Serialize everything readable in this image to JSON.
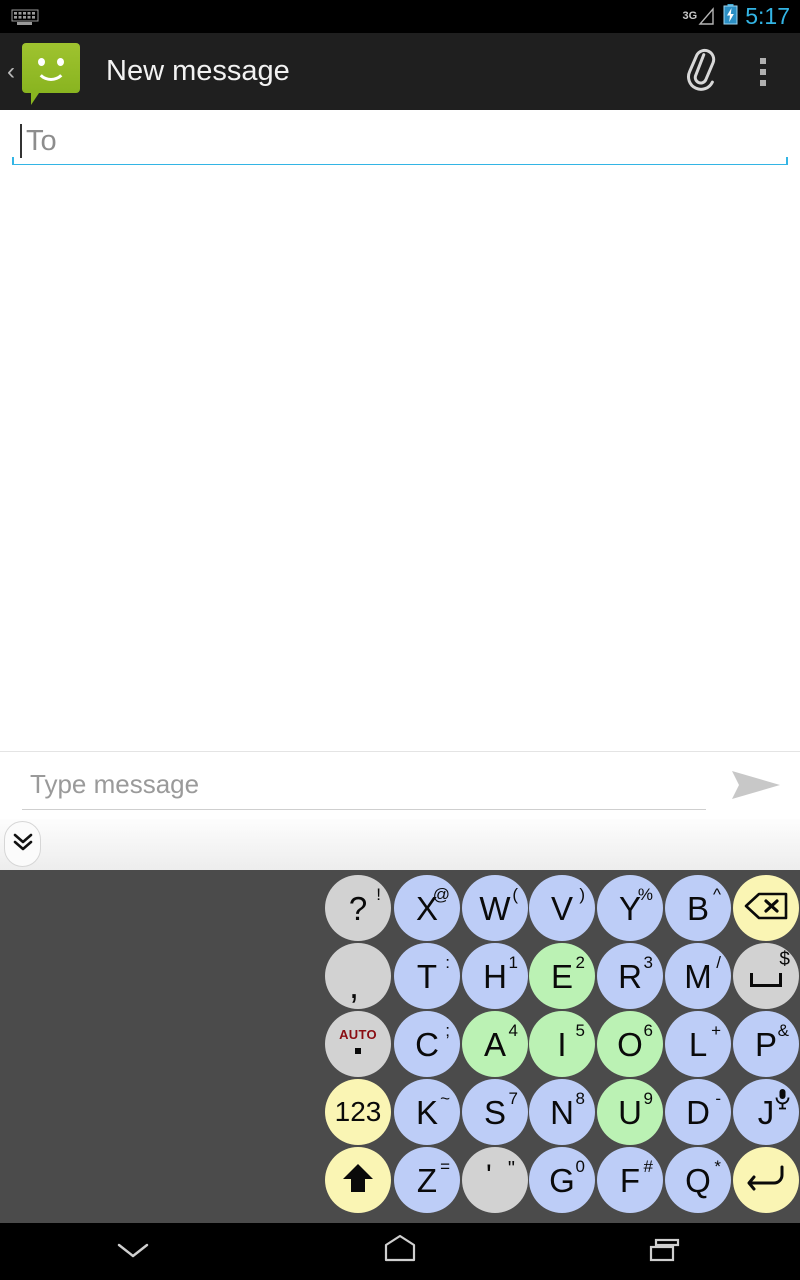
{
  "status_bar": {
    "keyboard_icon": "keyboard-icon",
    "network_type": "3G",
    "signal_icon": "signal-bars-icon",
    "battery_icon": "battery-charging-icon",
    "time": "5:17"
  },
  "action_bar": {
    "back_chevron": "‹",
    "app_icon": "messaging-app-icon",
    "title": "New message",
    "attach_icon": "paperclip-icon",
    "overflow_icon": "overflow-menu-icon"
  },
  "recipient": {
    "placeholder": "To",
    "value": "",
    "underline_color": "#33b5e5"
  },
  "compose": {
    "placeholder": "Type message",
    "value": "",
    "send_icon": "send-arrow-icon"
  },
  "keyboard_strip": {
    "hide_keyboard_icon": "double-chevron-down-icon"
  },
  "keyboard": {
    "background": "#4b4b4b",
    "colors": {
      "consonant": "#bdcdf7",
      "vowel": "#bbf2b4",
      "punctuation": "#d2d2d2",
      "function": "#faf5b4"
    },
    "rows": [
      [
        {
          "main": "?",
          "alt": "!",
          "type": "punctuation",
          "name": "key-question"
        },
        {
          "main": "X",
          "alt": "@",
          "type": "consonant",
          "name": "key-x"
        },
        {
          "main": "W",
          "alt": "(",
          "type": "consonant",
          "name": "key-w"
        },
        {
          "main": "V",
          "alt": ")",
          "type": "consonant",
          "name": "key-v"
        },
        {
          "main": "Y",
          "alt": "%",
          "type": "consonant",
          "name": "key-y"
        },
        {
          "main": "B",
          "alt": "^",
          "type": "consonant",
          "name": "key-b"
        },
        {
          "main": "",
          "alt": "",
          "type": "function",
          "icon": "backspace-icon",
          "name": "key-backspace"
        }
      ],
      [
        {
          "main": ",",
          "alt": "",
          "type": "punctuation",
          "name": "key-comma"
        },
        {
          "main": "T",
          "alt": ":",
          "type": "consonant",
          "name": "key-t"
        },
        {
          "main": "H",
          "alt": "1",
          "type": "consonant",
          "name": "key-h"
        },
        {
          "main": "E",
          "alt": "2",
          "type": "vowel",
          "name": "key-e"
        },
        {
          "main": "R",
          "alt": "3",
          "type": "consonant",
          "name": "key-r"
        },
        {
          "main": "M",
          "alt": "/",
          "type": "consonant",
          "name": "key-m"
        },
        {
          "main": "",
          "alt": "$",
          "type": "punctuation",
          "icon": "space-icon",
          "name": "key-space"
        }
      ],
      [
        {
          "main": "AUTO",
          "alt": ".",
          "type": "punctuation",
          "icon": "auto-punctuation-icon",
          "name": "key-auto-period"
        },
        {
          "main": "C",
          "alt": ";",
          "type": "consonant",
          "name": "key-c"
        },
        {
          "main": "A",
          "alt": "4",
          "type": "vowel",
          "name": "key-a"
        },
        {
          "main": "I",
          "alt": "5",
          "type": "vowel",
          "name": "key-i"
        },
        {
          "main": "O",
          "alt": "6",
          "type": "vowel",
          "name": "key-o"
        },
        {
          "main": "L",
          "alt": "+",
          "type": "consonant",
          "name": "key-l"
        },
        {
          "main": "P",
          "alt": "&",
          "type": "consonant",
          "name": "key-p"
        }
      ],
      [
        {
          "main": "123",
          "alt": "",
          "type": "function",
          "name": "key-numbers"
        },
        {
          "main": "K",
          "alt": "~",
          "type": "consonant",
          "name": "key-k"
        },
        {
          "main": "S",
          "alt": "7",
          "type": "consonant",
          "name": "key-s"
        },
        {
          "main": "N",
          "alt": "8",
          "type": "consonant",
          "name": "key-n"
        },
        {
          "main": "U",
          "alt": "9",
          "type": "vowel",
          "name": "key-u"
        },
        {
          "main": "D",
          "alt": "-",
          "type": "consonant",
          "name": "key-d"
        },
        {
          "main": "J",
          "alt": "",
          "type": "consonant",
          "icon": "microphone-icon",
          "name": "key-j"
        }
      ],
      [
        {
          "main": "",
          "alt": "",
          "type": "function",
          "icon": "shift-icon",
          "name": "key-shift"
        },
        {
          "main": "Z",
          "alt": "=",
          "type": "consonant",
          "name": "key-z"
        },
        {
          "main": "'",
          "alt": "\"",
          "type": "punctuation",
          "name": "key-apostrophe"
        },
        {
          "main": "G",
          "alt": "0",
          "type": "consonant",
          "name": "key-g"
        },
        {
          "main": "F",
          "alt": "#",
          "type": "consonant",
          "name": "key-f"
        },
        {
          "main": "Q",
          "alt": "*",
          "type": "consonant",
          "name": "key-q"
        },
        {
          "main": "",
          "alt": "",
          "type": "function",
          "icon": "enter-icon",
          "name": "key-enter"
        }
      ]
    ]
  },
  "nav_bar": {
    "back_icon": "back-chevron-down-icon",
    "home_icon": "home-icon",
    "recents_icon": "recents-icon"
  }
}
